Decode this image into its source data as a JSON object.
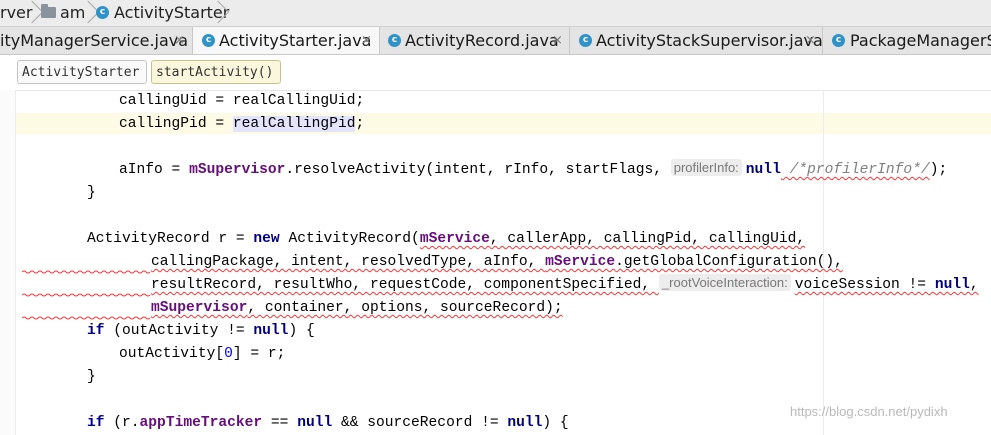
{
  "breadcrumb": {
    "items": [
      {
        "label": "rver",
        "icon": "none"
      },
      {
        "label": "am",
        "icon": "folder-icon"
      },
      {
        "label": "ActivityStarter",
        "icon": "class-icon"
      }
    ]
  },
  "tabs": [
    {
      "label": "ityManagerService.java",
      "close": "×",
      "active": false,
      "icon": "none"
    },
    {
      "label": "ActivityStarter.java",
      "close": "×",
      "active": true,
      "icon": "class-icon"
    },
    {
      "label": "ActivityRecord.java",
      "close": "×",
      "active": false,
      "icon": "class-icon"
    },
    {
      "label": "ActivityStackSupervisor.java",
      "close": "×",
      "active": false,
      "icon": "class-icon"
    },
    {
      "label": "PackageManagerSe",
      "close": "",
      "active": false,
      "icon": "class-icon"
    }
  ],
  "structure": {
    "class_name": "ActivityStarter",
    "method_name": "startActivity()"
  },
  "code": {
    "l1_a": "callingUid = realCallingUid;",
    "l2_a": "callingPid = ",
    "l2_b": "realCallingPid",
    "l2_c": ";",
    "l3_a": "aInfo = ",
    "l3_b": "mSupervisor",
    "l3_c": ".resolveActivity(intent, rInfo, startFlags, ",
    "l3_hint": "profilerInfo:",
    "l3_d": "null",
    "l3_e": " /*profilerInfo*/",
    "l3_f": ");",
    "l4": "}",
    "l5_a": "ActivityRecord r = ",
    "l5_b": "new",
    "l5_c": " ActivityRecord(",
    "l5_d": "mService",
    "l5_e": ", callerApp, callingPid, callingUid,",
    "l6_a": "callingPackage, intent, resolvedType, aInfo, ",
    "l6_b": "mService",
    "l6_c": ".getGlobalConfiguration(),",
    "l7_a": "resultRecord, resultWho, requestCode, componentSpecified, ",
    "l7_hint": "_rootVoiceInteraction:",
    "l7_b": "voiceSession != ",
    "l7_c": "null",
    "l7_d": ",",
    "l8_a": "mSupervisor",
    "l8_b": ", container, options, sourceRecord);",
    "l9_a": "if",
    "l9_b": " (outActivity != ",
    "l9_c": "null",
    "l9_d": ") {",
    "l10_a": "outActivity[",
    "l10_b": "0",
    "l10_c": "] = r;",
    "l11": "}",
    "l12_a": "if",
    "l12_b": " (r.",
    "l12_c": "appTimeTracker",
    "l12_d": " == ",
    "l12_e": "null",
    "l12_f": " && sourceRecord != ",
    "l12_g": "null",
    "l12_h": ") {"
  },
  "watermark": "https://blog.csdn.net/pydixh",
  "colors": {
    "keyword": "#000080",
    "field": "#660e7a",
    "number": "#0000ff",
    "comment": "#808080",
    "error_underline": "#ff3333",
    "caret_line": "#fdfbe6",
    "class_icon": "#2f93c9"
  }
}
